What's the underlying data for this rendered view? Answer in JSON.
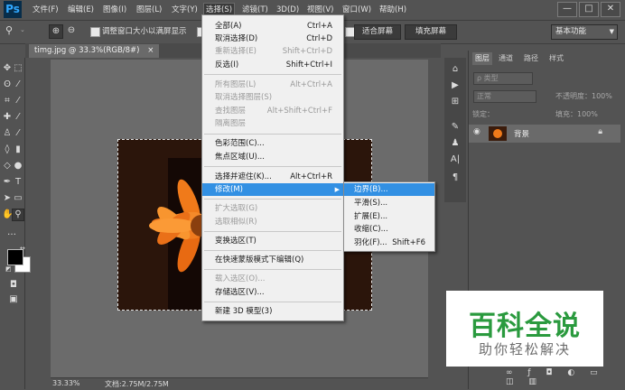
{
  "app": {
    "logo": "Ps"
  },
  "menubar": {
    "items": [
      "文件(F)",
      "编辑(E)",
      "图像(I)",
      "图层(L)",
      "文字(Y)",
      "选择(S)",
      "滤镜(T)",
      "3D(D)",
      "视图(V)",
      "窗口(W)",
      "帮助(H)"
    ],
    "active_index": 5
  },
  "window_controls": {
    "minimize": "—",
    "maximize": "□",
    "close": "✕"
  },
  "options_bar": {
    "resize_windows_label": "调整窗口大小以满屏显示",
    "fit_screen": "适合屏幕",
    "fill_screen": "填充屏幕",
    "workspace": "基本功能"
  },
  "document": {
    "tab_title": "timg.jpg @ 33.3%(RGB/8#)",
    "close": "×"
  },
  "select_menu": {
    "items": [
      {
        "label": "全部(A)",
        "shortcut": "Ctrl+A",
        "disabled": false
      },
      {
        "label": "取消选择(D)",
        "shortcut": "Ctrl+D",
        "disabled": false
      },
      {
        "label": "重新选择(E)",
        "shortcut": "Shift+Ctrl+D",
        "disabled": true
      },
      {
        "label": "反选(I)",
        "shortcut": "Shift+Ctrl+I",
        "disabled": false
      },
      {
        "label": "所有图层(L)",
        "shortcut": "Alt+Ctrl+A",
        "disabled": true
      },
      {
        "label": "取消选择图层(S)",
        "shortcut": "",
        "disabled": true
      },
      {
        "label": "查找图层",
        "shortcut": "Alt+Shift+Ctrl+F",
        "disabled": true
      },
      {
        "label": "隔离图层",
        "shortcut": "",
        "disabled": true
      },
      {
        "label": "色彩范围(C)...",
        "shortcut": "",
        "disabled": false
      },
      {
        "label": "焦点区域(U)...",
        "shortcut": "",
        "disabled": false
      },
      {
        "label": "选择并遮住(K)...",
        "shortcut": "Alt+Ctrl+R",
        "disabled": false
      },
      {
        "label": "修改(M)",
        "shortcut": "",
        "disabled": false
      },
      {
        "label": "扩大选取(G)",
        "shortcut": "",
        "disabled": true
      },
      {
        "label": "选取相似(R)",
        "shortcut": "",
        "disabled": true
      },
      {
        "label": "变换选区(T)",
        "shortcut": "",
        "disabled": false
      },
      {
        "label": "在快速蒙版模式下编辑(Q)",
        "shortcut": "",
        "disabled": false
      },
      {
        "label": "载入选区(O)...",
        "shortcut": "",
        "disabled": true
      },
      {
        "label": "存储选区(V)...",
        "shortcut": "",
        "disabled": false
      },
      {
        "label": "新建 3D 模型(3)",
        "shortcut": "",
        "disabled": false
      }
    ],
    "highlighted_index": 11
  },
  "modify_submenu": {
    "items": [
      {
        "label": "边界(B)...",
        "shortcut": ""
      },
      {
        "label": "平滑(S)...",
        "shortcut": ""
      },
      {
        "label": "扩展(E)...",
        "shortcut": ""
      },
      {
        "label": "收缩(C)...",
        "shortcut": ""
      },
      {
        "label": "羽化(F)...",
        "shortcut": "Shift+F6"
      }
    ],
    "highlighted_index": 0
  },
  "layers_panel": {
    "tabs": [
      "图层",
      "通道",
      "路径",
      "样式"
    ],
    "kind_filter": "ρ 类型",
    "blend_mode": "正常",
    "opacity_label": "不透明度：100%",
    "lock_label": "锁定：",
    "fill_label": "填充：100%",
    "layer_name": "背景"
  },
  "status": {
    "zoom": "33.33%",
    "doc_info": "文档:2.75M/2.75M"
  },
  "watermark": {
    "title": "百科全说",
    "subtitle": "助你轻松解决"
  },
  "colors": {
    "highlight": "#3290e3",
    "panel_bg": "#535353",
    "watermark_green": "#2a9a3e"
  }
}
